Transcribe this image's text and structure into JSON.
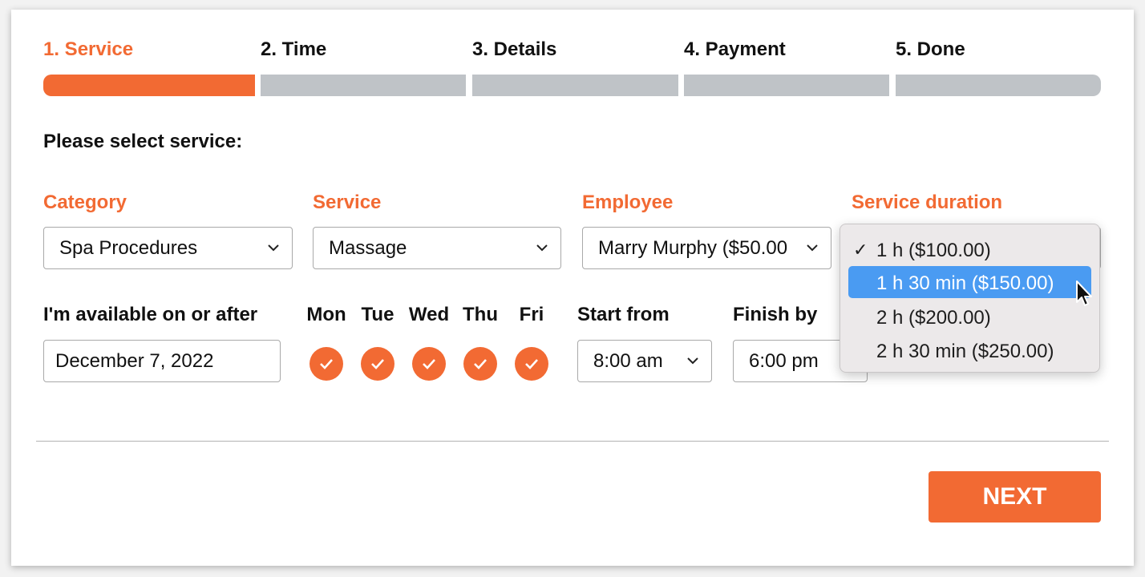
{
  "steps": [
    {
      "label": "1. Service",
      "active": true
    },
    {
      "label": "2. Time",
      "active": false
    },
    {
      "label": "3. Details",
      "active": false
    },
    {
      "label": "4. Payment",
      "active": false
    },
    {
      "label": "5. Done",
      "active": false
    }
  ],
  "heading": "Please select service:",
  "fields": {
    "category": {
      "label": "Category",
      "value": "Spa Procedures"
    },
    "service": {
      "label": "Service",
      "value": "Massage"
    },
    "employee": {
      "label": "Employee",
      "value": "Marry Murphy ($50.00"
    },
    "duration": {
      "label": "Service duration",
      "value": "1 h ($100.00)"
    }
  },
  "availability": {
    "label": "I'm available on or after",
    "date": "December 7, 2022",
    "days": [
      {
        "label": "Mon",
        "checked": true
      },
      {
        "label": "Tue",
        "checked": true
      },
      {
        "label": "Wed",
        "checked": true
      },
      {
        "label": "Thu",
        "checked": true
      },
      {
        "label": "Fri",
        "checked": true
      }
    ],
    "start_label": "Start from",
    "start_value": "8:00 am",
    "finish_label": "Finish by",
    "finish_value": "6:00 pm"
  },
  "dropdown": {
    "options": [
      {
        "label": "1 h ($100.00)",
        "selected": true,
        "highlighted": false
      },
      {
        "label": "1 h 30 min ($150.00)",
        "selected": false,
        "highlighted": true
      },
      {
        "label": "2 h ($200.00)",
        "selected": false,
        "highlighted": false
      },
      {
        "label": "2 h 30 min ($250.00)",
        "selected": false,
        "highlighted": false
      }
    ],
    "check_mark": "✓"
  },
  "next_button": "NEXT",
  "colors": {
    "accent": "#f26a33",
    "inactive_step": "#bfc3c7",
    "highlight": "#4a9bf2"
  }
}
